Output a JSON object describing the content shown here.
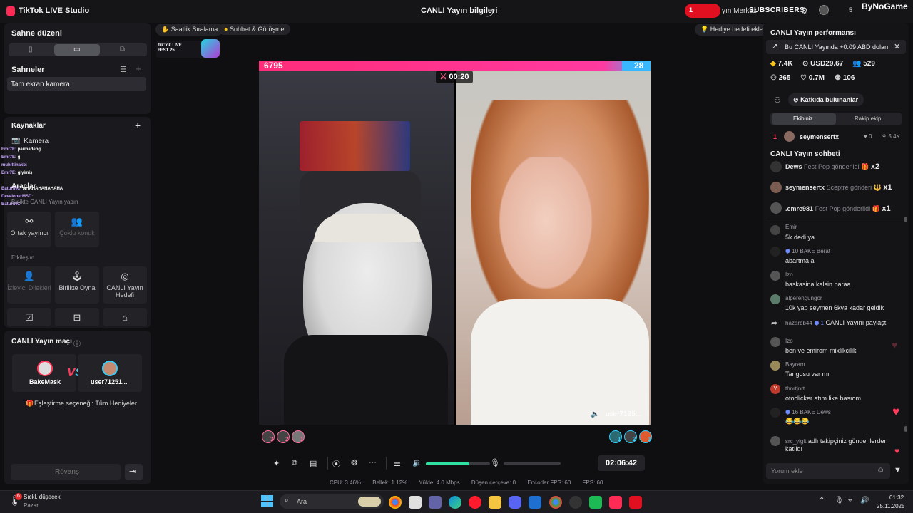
{
  "titlebar": {
    "app_name": "TikTok LIVE Studio",
    "live_info": "CANLI Yayın bilgileri",
    "live_center": "yın Merkez",
    "subscribers": "SUBSCRIBERS",
    "badge_count": "1",
    "count_right": "5",
    "watermark": "ByNoGame"
  },
  "left": {
    "scene_layout_title": "Sahne düzeni",
    "scenes_title": "Sahneler",
    "scene_item": "Tam ekran kamera",
    "sources_title": "Kaynaklar",
    "source_item": "Kamera",
    "tools_title": "Araçlar",
    "tools_subtitle": "Birlikte CANLI Yayın yapın",
    "tools": [
      {
        "label": "Ortak yayıncı"
      },
      {
        "label": "Çoklu konuk"
      }
    ],
    "interaction_title": "Etkileşim",
    "interaction": [
      {
        "label": "İzleyici Dilekleri"
      },
      {
        "label": "Birlikte Oyna"
      },
      {
        "label": "CANLI Yayın Hedefi"
      }
    ],
    "match_title": "CANLI Yayın maçı",
    "match_left": "BakeMask",
    "match_right": "user71251...",
    "match_option": "Eşleştirme seçeneği: Tüm Hediyeler",
    "rematch_button": "Rövanş"
  },
  "overlay_chat": [
    {
      "user": "Emr7E",
      "text": "parmadeng"
    },
    {
      "user": "Emr7E",
      "text": "g"
    },
    {
      "user": "muhittinakb",
      "text": ""
    },
    {
      "user": "Emr7E",
      "text": "giyimiş"
    },
    {
      "user": "",
      "text": ""
    },
    {
      "user": "BatuHNC",
      "text": "AHAHAHAHAHAHA"
    },
    {
      "user": "DeveloperMSD",
      "text": ""
    },
    {
      "user": "BatuHNC",
      "text": ""
    }
  ],
  "stage": {
    "chip_hourly": "Saatlik Sıralama",
    "chip_chat": "Sohbet & Görüşme",
    "gift_goal": "Hediye hedefi ekle",
    "fest_label": "TikTok LIVE FEST 25",
    "score_left": "6795",
    "score_right": "28",
    "timer": "00:20",
    "opponent": "user7125...",
    "left_ranks": [
      "3",
      "2",
      "1"
    ],
    "right_ranks": [
      "1",
      "2",
      "3"
    ],
    "clock": "02:06:42",
    "stats": {
      "cpu": "CPU: 3.46%",
      "mem": "Bellek: 1.12%",
      "load": "Yükle: 4.0 Mbps",
      "dropped": "Düşen çerçeve: 0",
      "encoder": "Encoder FPS: 60",
      "fps": "FPS: 60"
    },
    "volume_fraction": 0.68
  },
  "right": {
    "perf_title": "CANLI Yayın performansı",
    "earnings_banner": "Bu CANLI Yayında +0.09 ABD doları",
    "metrics": [
      {
        "icon": "diamond-icon",
        "value": "7.4K"
      },
      {
        "icon": "coin-icon",
        "value": "USD29.67"
      },
      {
        "icon": "users-icon",
        "value": "529"
      },
      {
        "icon": "viewers-icon",
        "value": "265"
      },
      {
        "icon": "heart-icon",
        "value": "0.7M"
      },
      {
        "icon": "followers-icon",
        "value": "106"
      }
    ],
    "contributors_button": "Katkıda bulunanlar",
    "tab_your_team": "Ekibiniz",
    "tab_rival_team": "Rakip ekip",
    "top_contributor": {
      "rank": "1",
      "name": "seymensertx",
      "likes": "0",
      "score": "5.4K"
    },
    "chat_title": "CANLI Yayın sohbeti",
    "gifts": [
      {
        "user": "Dews",
        "text": "Fest Pop gönderildi",
        "count": "x2"
      },
      {
        "user": "seymensertx",
        "text": "Sceptre gönderi",
        "count": "x1"
      },
      {
        "user": ".emre981",
        "text": "Fest Pop gönderildi",
        "count": "x1"
      }
    ],
    "chat": [
      {
        "name": "Emir",
        "text": "5k dedi ya"
      },
      {
        "name": "10 BAKE Berat",
        "text": "abartma a"
      },
      {
        "name": "Izo",
        "text": "baskasina kalsin paraa"
      },
      {
        "name": "alperengungor_",
        "text": "10k yap seymen 6kya kadar geldik"
      },
      {
        "name": "hazarbb44",
        "text": "CANLI Yayını paylaştı"
      },
      {
        "name": "Izo",
        "text": "ben ve emirom mixlikcilik"
      },
      {
        "name": "Bayram",
        "text": "Tangosu var mı"
      },
      {
        "name": "thnrtjnrt",
        "text": "otoclicker atım like basıom"
      },
      {
        "name": "16 BAKE Dews",
        "text": ""
      },
      {
        "name": "src_yigit",
        "text": "adlı takipçiniz gönderilerden katıldı"
      }
    ],
    "comment_placeholder": "Yorum ekle"
  },
  "taskbar": {
    "weather_title": "Sıckl. düşecek",
    "weather_sub": "Pazar",
    "weather_badge": "6",
    "search_placeholder": "Ara",
    "time": "01:32",
    "date": "25.11.2025"
  },
  "colors": {
    "accent": "#fe2c55",
    "score_bar": "#ff2d7a",
    "volume": "#2fe0a0",
    "heart": "#ff3b5c"
  }
}
